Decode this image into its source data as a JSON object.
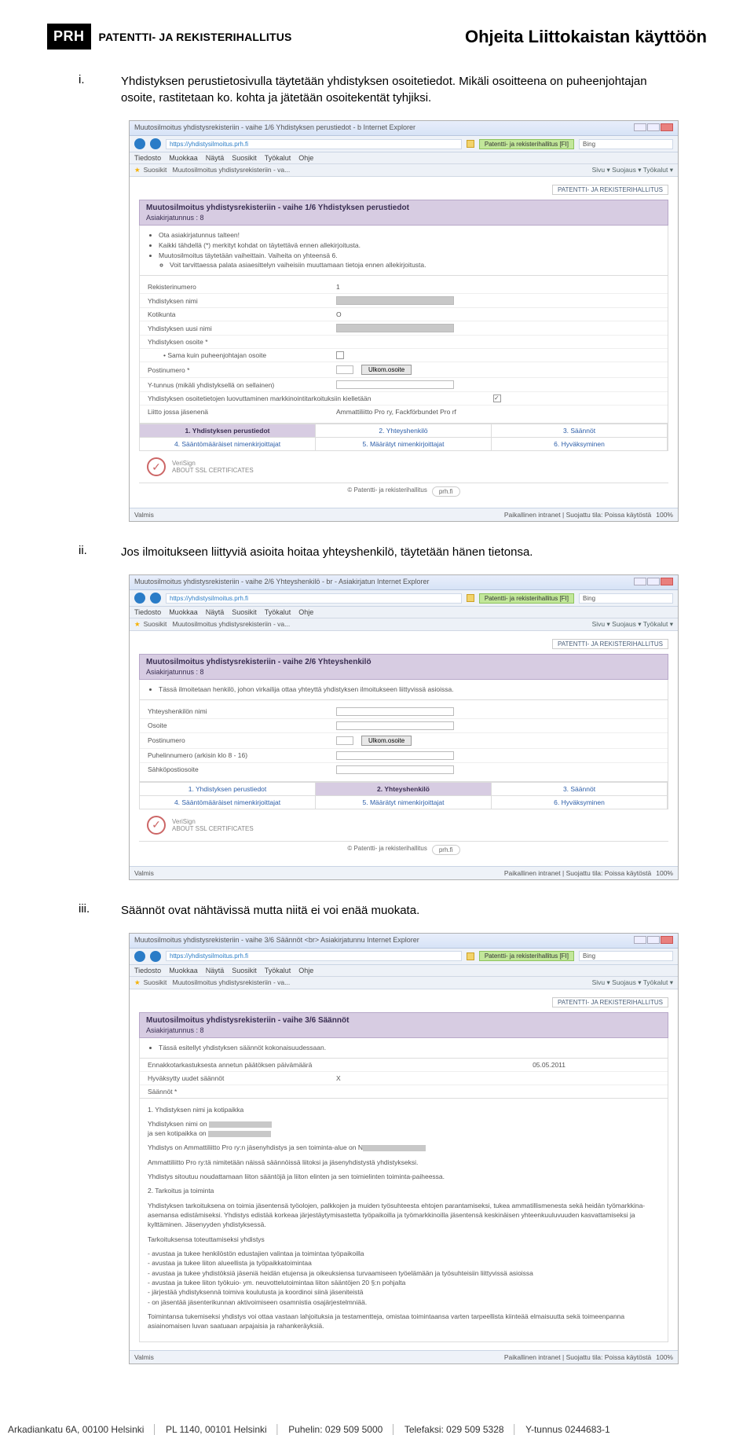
{
  "header": {
    "logo_short": "PRH",
    "logo_text": "PATENTTI- JA REKISTERIHALLITUS",
    "doc_title": "Ohjeita Liittokaistan käyttöön"
  },
  "items": [
    {
      "marker": "i.",
      "text": "Yhdistyksen perustietosivulla täytetään yhdistyksen osoitetiedot. Mikäli osoitteena on puheenjohtajan osoite, rastitetaan ko. kohta ja jätetään osoitekentät tyhjiksi."
    },
    {
      "marker": "ii.",
      "text": "Jos ilmoitukseen liittyviä asioita hoitaa yhteyshenkilö, täytetään hänen tietonsa."
    },
    {
      "marker": "iii.",
      "text": "Säännöt ovat nähtävissä mutta niitä ei voi enää muokata."
    }
  ],
  "browser": {
    "menu": [
      "Tiedosto",
      "Muokkaa",
      "Näytä",
      "Suosikit",
      "Työkalut",
      "Ohje"
    ],
    "fav_star": "★",
    "fav_label": "Suosikit",
    "tab_prefix": "Muutosilmoitus yhdistysrekisteriin - va...",
    "tools_right": "Sivu ▾   Suojaus ▾   Työkalut ▾",
    "ie_suffix": "Internet Explorer",
    "cert_label": "Patentti- ja rekisterihallitus [FI]",
    "search_engine": "Bing",
    "status_left": "Valmis",
    "status_right": "Paikallinen intranet | Suojattu tila: Poissa käytöstä",
    "zoom": "100%"
  },
  "sc1": {
    "win_title": "Muutosilmoitus yhdistysrekisteriin - vaihe 1/6 Yhdistyksen perustiedot - b",
    "url": "https://yhdistysilmoitus.prh.fi",
    "head_title": "Muutosilmoitus yhdistysrekisteriin - vaihe 1/6 Yhdistyksen perustiedot",
    "head_sub": "Asiakirjatunnus : 8",
    "bullets": {
      "a": "Ota asiakirjatunnus talteen!",
      "b": "Kaikki tähdellä (*) merkityt kohdat on täytettävä ennen allekirjoitusta.",
      "c": "Muutosilmoitus täytetään vaiheittain. Vaiheita on yhteensä 6.",
      "c1": "Voit tarvittaessa palata asiaesittelyn vaiheisiin muuttamaan tietoja ennen allekirjoitusta."
    },
    "rows": {
      "rekisterinumero": "Rekisterinumero",
      "yhd_nimi": "Yhdistyksen nimi",
      "kotikunta": "Kotikunta",
      "uusi_nimi": "Yhdistyksen uusi nimi",
      "osoite": "Yhdistyksen osoite *",
      "radio": "Sama kuin puheenjohtajan osoite",
      "postinumero": "Postinumero *",
      "ulkom": "Ulkom.osoite",
      "ytunnus": "Y-tunnus (mikäli yhdistyksellä on sellainen)",
      "suoja": "Yhdistyksen osoitetietojen luovuttaminen markkinointitarkoituksiin kielletään",
      "jasen": "Liitto jossa jäsenenä",
      "jasen_val": "Ammattiliitto Pro ry, Fackförbundet Pro rf"
    },
    "tabs": [
      "1. Yhdistyksen perustiedot",
      "2. Yhteyshenkilö",
      "3. Säännöt",
      "4. Sääntömääräiset nimenkirjoittajat",
      "5. Määrätyt nimenkirjoittajat",
      "6. Hyväksyminen"
    ],
    "foot": "© Patentti- ja rekisterihallitus"
  },
  "sc2": {
    "win_title": "Muutosilmoitus yhdistysrekisteriin - vaihe 2/6 Yhteyshenkilö - br - Asiakirjatun",
    "url": "https://yhdistysilmoitus.prh.fi",
    "head_title": "Muutosilmoitus yhdistysrekisteriin - vaihe 2/6 Yhteyshenkilö",
    "head_sub": "Asiakirjatunnus : 8",
    "info": "Tässä ilmoitetaan henkilö, johon virkailija ottaa yhteyttä yhdistyksen ilmoitukseen liittyvissä asioissa.",
    "rows": {
      "nimi": "Yhteyshenkilön nimi",
      "osoite": "Osoite",
      "postinumero": "Postinumero",
      "ulkom": "Ulkom.osoite",
      "puh": "Puhelinnumero (arkisin klo 8 - 16)",
      "email": "Sähköpostiosoite"
    },
    "tabs": [
      "1. Yhdistyksen perustiedot",
      "2. Yhteyshenkilö",
      "3. Säännöt",
      "4. Sääntömääräiset nimenkirjoittajat",
      "5. Määrätyt nimenkirjoittajat",
      "6. Hyväksyminen"
    ],
    "foot": "© Patentti- ja rekisterihallitus"
  },
  "sc3": {
    "win_title": "Muutosilmoitus yhdistysrekisteriin - vaihe 3/6 Säännöt <br> Asiakirjatunnu",
    "url": "https://yhdistysilmoitus.prh.fi",
    "head_title": "Muutosilmoitus yhdistysrekisteriin - vaihe 3/6 Säännöt",
    "head_sub": "Asiakirjatunnus : 8",
    "info": "Tässä esitellyt yhdistyksen säännöt kokonaisuudessaan.",
    "lines": {
      "a_l": "Ennakkotarkastuksesta annetun päätöksen päivämäärä",
      "a_r": "05.05.2011",
      "b_l": "Hyväksytty uudet säännöt",
      "saannot": "Säännöt *",
      "r1": "1. Yhdistyksen nimi ja kotipaikka",
      "r2a": "Yhdistyksen nimi on ",
      "r2b": "ja sen kotipaikka on ",
      "r3": "Yhdistys on Ammattiliitto Pro ry:n jäsenyhdistys ja sen toiminta-alue on N",
      "r4": "Ammattiliitto Pro ry:tä nimitetään näissä säännöissä liitoksi ja jäsenyhdistystä yhdistykseksi.",
      "r5": "Yhdistys sitoutuu noudattamaan liiton sääntöjä ja liiton elinten ja sen toimielinten toiminta-paiheessa.",
      "r6": "2. Tarkoitus ja toiminta",
      "r7": "Yhdistyksen tarkoituksena on toimia jäsentensä työolojen, palkkojen ja muiden työsuhteesta ehtojen parantamiseksi, tukea ammatillismenesta sekä heidän työmarkkina-asemansa edistämiseksi. Yhdistys edistää korkeaa järjestäytymisastetta työpaikoilla ja työmarkkinoilla jäsentensä keskinäisen yhteenkuuluvuuden kasvattamiseksi ja kylttäminen. Jäsenyyden yhdistyksessä.",
      "r8": "Tarkoituksensa toteuttamiseksi yhdistys",
      "r9a": "- avustaa ja tukee henkilöstön edustajien valintaa ja toimintaa työpaikoilla",
      "r9b": "- avustaa ja tukee liiton alueellista ja työpaikkatoimintaa",
      "r9c": "- avustaa ja tukee yhdistöksiä jäseniä heidän etujensa ja oikeuksiensa turvaamiseen työelämään ja työsuhteisiin liittyvissä asioissa",
      "r9d": "- avustaa ja tukee liiton työkuio- ym. neuvottelutoimintaa liiton sääntöjen 20 §:n pohjalta",
      "r9e": "- järjestää yhdistyksennä toimiva koulutusta ja koordinoi siinä jäseniteistä",
      "r9f": "- on jäsentää jäsenterikunnan aktivoimiseen osamnistia osajärjestelmniää.",
      "r10": "Toimintansa tukemiseksi yhdistys voi ottaa vastaan lahjoituksia ja testamentteja, omistaa toimintaansa varten tarpeellista kiinteää elmaisuutta sekä toimeenpanna asiainomaisen luvan saatuaan arpajaisia ja rahankeräyksiä."
    }
  },
  "prh_badge": "PATENTTI- JA REKISTERIHALLITUS",
  "footer": {
    "addr1": "Arkadiankatu 6A, 00100 Helsinki",
    "addr2": "PL 1140, 00101 Helsinki",
    "phone": "Puhelin: 029 509 5000",
    "fax": "Telefaksi: 029 509 5328",
    "yt": "Y-tunnus 0244683-1"
  }
}
